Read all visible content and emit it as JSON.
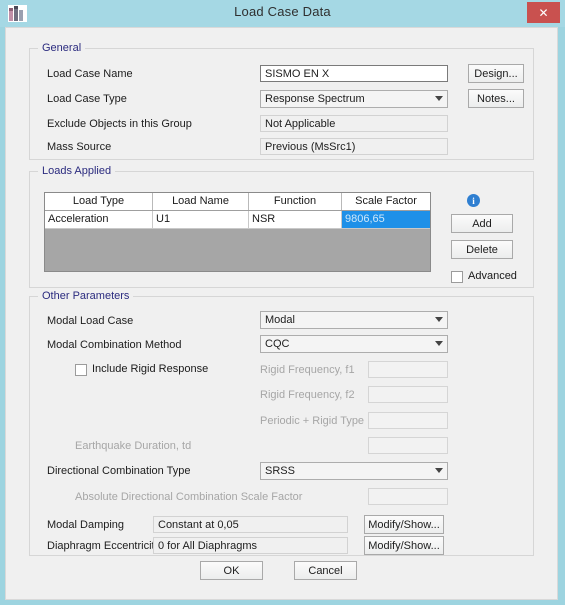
{
  "window": {
    "title": "Load Case Data",
    "icon": "etabs-app-icon",
    "close_label": "✕",
    "titlebar_color": "#a5d8e4",
    "close_color": "#c9514f"
  },
  "general": {
    "legend": "General",
    "rows": [
      {
        "label": "Load Case Name",
        "value": "SISMO EN X",
        "type": "text"
      },
      {
        "label": "Load Case Type",
        "value": "Response Spectrum",
        "type": "combo"
      },
      {
        "label": "Exclude Objects in this Group",
        "value": "Not Applicable",
        "type": "readonly"
      },
      {
        "label": "Mass Source",
        "value": "Previous  (MsSrc1)",
        "type": "readonly"
      }
    ],
    "design_button": "Design...",
    "notes_button": "Notes..."
  },
  "loads_applied": {
    "legend": "Loads Applied",
    "columns": [
      "Load Type",
      "Load Name",
      "Function",
      "Scale Factor"
    ],
    "rows": [
      {
        "load_type": "Acceleration",
        "load_name": "U1",
        "function": "NSR",
        "scale_factor": "9806,65",
        "selected_cell": "scale_factor"
      }
    ],
    "info_icon": "info-icon",
    "info_glyph": "i",
    "add_button": "Add",
    "delete_button": "Delete",
    "advanced_checkbox": {
      "label": "Advanced",
      "checked": false
    }
  },
  "other_parameters": {
    "legend": "Other Parameters",
    "modal_load_case": {
      "label": "Modal Load Case",
      "value": "Modal"
    },
    "modal_combination_method": {
      "label": "Modal Combination Method",
      "value": "CQC"
    },
    "include_rigid_response": {
      "label": "Include Rigid Response",
      "checked": false
    },
    "rigid_frequency_f1": {
      "label": "Rigid Frequency, f1",
      "value": "",
      "disabled": true
    },
    "rigid_frequency_f2": {
      "label": "Rigid Frequency, f2",
      "value": "",
      "disabled": true
    },
    "periodic_rigid_type": {
      "label": "Periodic + Rigid Type",
      "value": "",
      "disabled": true
    },
    "earthquake_duration": {
      "label": "Earthquake Duration, td",
      "value": "",
      "disabled": true
    },
    "directional_combination_type": {
      "label": "Directional Combination Type",
      "value": "SRSS"
    },
    "absolute_directional_scale_factor": {
      "label": "Absolute Directional Combination Scale Factor",
      "value": "",
      "disabled": true
    },
    "modal_damping": {
      "label": "Modal Damping",
      "value": "Constant at 0,05",
      "button": "Modify/Show..."
    },
    "diaphragm_eccentricity": {
      "label": "Diaphragm Eccentricity",
      "value": "0 for All Diaphragms",
      "button": "Modify/Show..."
    }
  },
  "footer": {
    "ok_button": "OK",
    "cancel_button": "Cancel"
  }
}
